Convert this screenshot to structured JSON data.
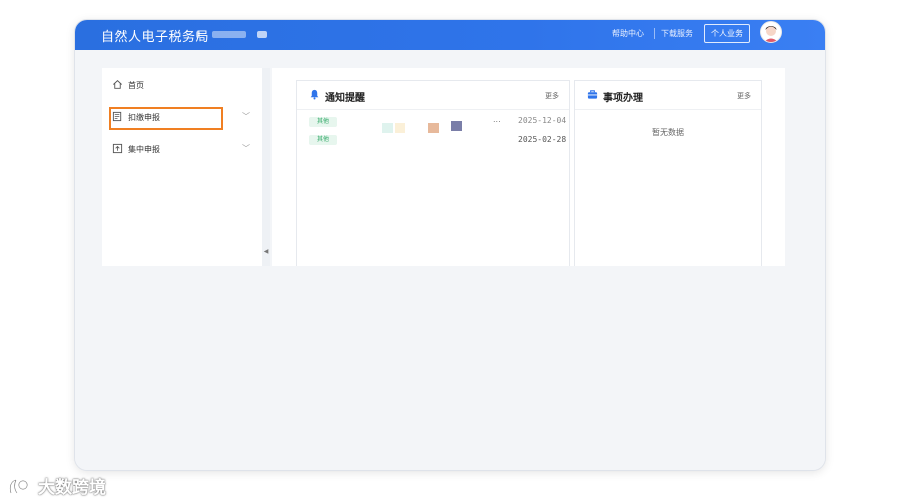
{
  "header": {
    "brand": "自然人电子税务局",
    "links": [
      "帮助中心",
      "下载服务"
    ],
    "business_button": "个人业务"
  },
  "sidebar": {
    "items": [
      {
        "label": "首页",
        "icon": "home-icon"
      },
      {
        "label": "扣缴申报",
        "icon": "report-form-icon",
        "expandable": true,
        "highlighted": true
      },
      {
        "label": "集中申报",
        "icon": "upload-box-icon",
        "expandable": true
      }
    ],
    "collapse_icon": "chevron-left-icon"
  },
  "notice_panel": {
    "title": "通知提醒",
    "more": "更多",
    "icon": "bell-icon",
    "rows": [
      {
        "tag": "其他",
        "date": "2025-12-04",
        "ellipsis": "..."
      },
      {
        "tag": "其他",
        "date": "2025-02-28"
      }
    ]
  },
  "task_panel": {
    "title": "事项办理",
    "more": "更多",
    "icon": "briefcase-icon",
    "empty_text": "暂无数据"
  },
  "watermark": {
    "text": "大数跨境"
  },
  "colors": {
    "header_blue": "#2f74ea",
    "highlight_orange": "#f07f22",
    "tag_green": "#2fa866"
  }
}
